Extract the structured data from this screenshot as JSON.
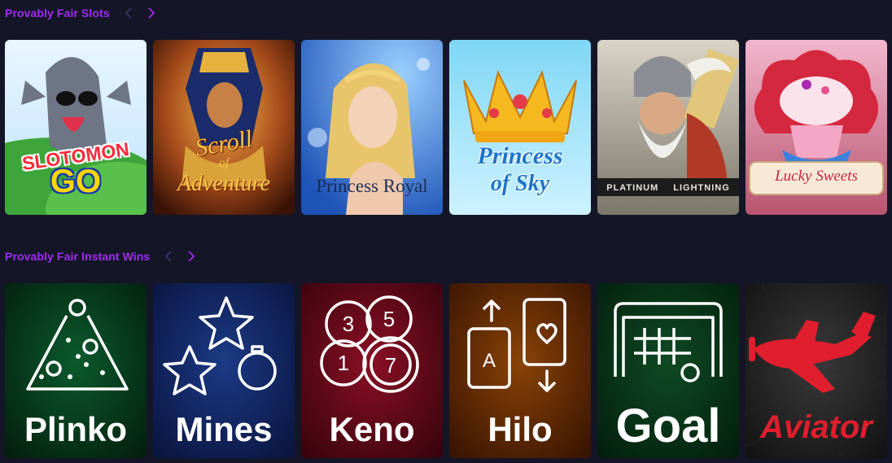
{
  "sections": [
    {
      "title": "Provably Fair Slots",
      "tiles": [
        {
          "name": "slotomon-go",
          "line1": "SLOTOMON",
          "line2": "GO"
        },
        {
          "name": "scroll-of-adventure",
          "line1": "Scroll",
          "line2": "of",
          "line3": "Adventure"
        },
        {
          "name": "princess-royal",
          "line1": "Princess Royal"
        },
        {
          "name": "princess-of-sky",
          "line1": "Princess",
          "line2": "of Sky"
        },
        {
          "name": "platinum-lightning",
          "line1": "PLATINUM",
          "line2": "LIGHTNING"
        },
        {
          "name": "lucky-sweets",
          "line1": "Lucky Sweets"
        }
      ]
    },
    {
      "title": "Provably Fair Instant Wins",
      "tiles": [
        {
          "name": "plinko",
          "label": "Plinko"
        },
        {
          "name": "mines",
          "label": "Mines"
        },
        {
          "name": "keno",
          "label": "Keno",
          "n1": "3",
          "n2": "5",
          "n3": "1",
          "n4": "7"
        },
        {
          "name": "hilo",
          "label": "Hilo",
          "card": "A"
        },
        {
          "name": "goal",
          "label": "Goal"
        },
        {
          "name": "aviator",
          "label": "Aviator"
        }
      ]
    }
  ],
  "colors": {
    "background": "#141627",
    "accent": "#a12cf0",
    "arrow_disabled": "#3a3560"
  },
  "icons": {
    "prev": "chevron-left-icon",
    "next": "chevron-right-icon"
  }
}
